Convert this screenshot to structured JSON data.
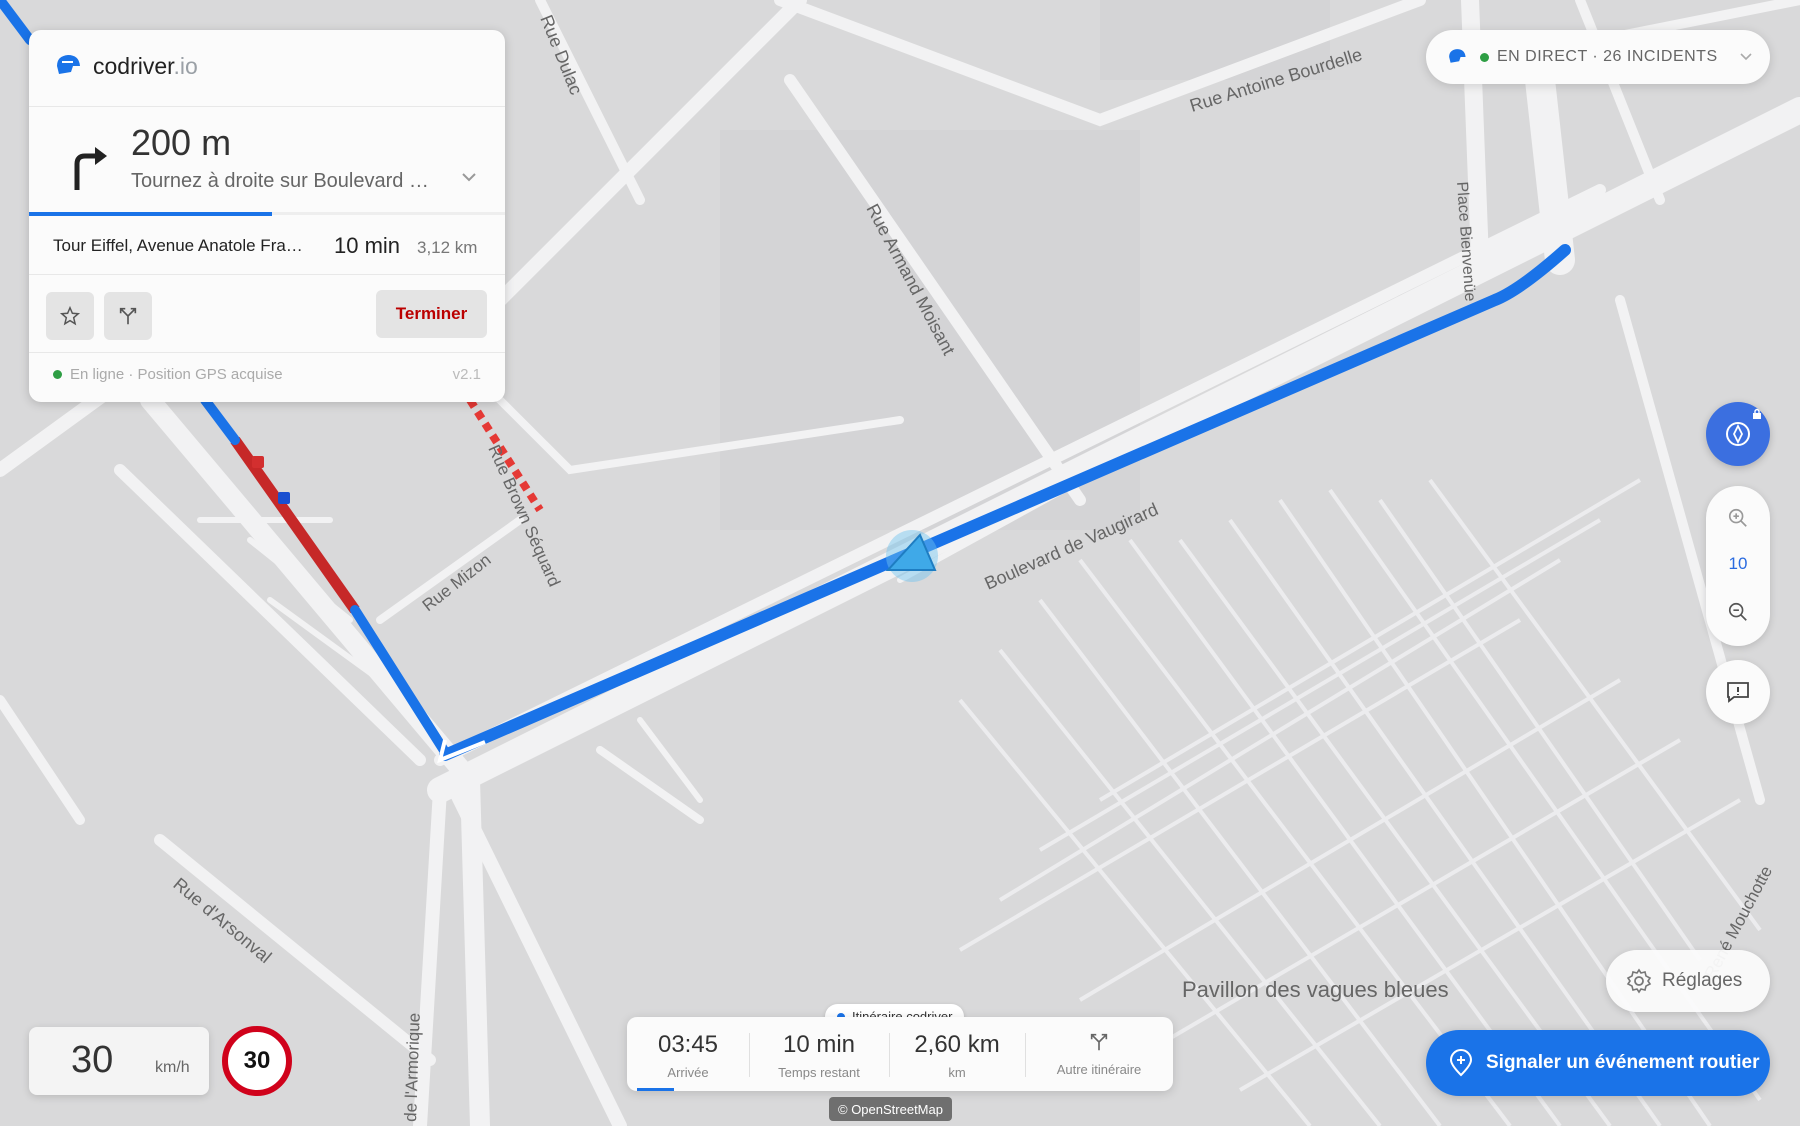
{
  "brand": {
    "name": "codriver",
    "tld": ".io"
  },
  "navigation": {
    "distance": "200 m",
    "instruction": "Tournez à droite sur Boulevard …",
    "destination": "Tour Eiffel, Avenue Anatole Fra…",
    "eta_duration": "10 min",
    "total_distance": "3,12 km",
    "end_label": "Terminer",
    "status": "En ligne · Position GPS acquise",
    "version": "v2.1",
    "progress": 0.51
  },
  "live": {
    "label": "EN DIRECT · 26 INCIDENTS"
  },
  "zoom": {
    "level": "10"
  },
  "settings": {
    "label": "Réglages"
  },
  "report": {
    "label": "Signaler un événement routier"
  },
  "speed": {
    "current": "30",
    "unit": "km/h",
    "limit": "30"
  },
  "trip": {
    "tag": "Itinéraire codriver",
    "arrival_time": "03:45",
    "arrival_label": "Arrivée",
    "remaining_time": "10 min",
    "remaining_label": "Temps restant",
    "remaining_distance": "2,60 km",
    "distance_unit": "km",
    "alt_route_label": "Autre itinéraire",
    "progress": 0.07
  },
  "attribution": "© OpenStreetMap",
  "map_labels": {
    "rue_dulac": "Rue Dulac",
    "rue_antoine_bourdelle": "Rue Antoine Bourdelle",
    "place_bienvenue": "Place Bienvenüe",
    "rue_armand_moisant": "Rue Armand Moisant",
    "boulevard_vaugirard": "Boulevard de Vaugirard",
    "rue_brown_sequard": "Rue Brown Séquard",
    "rue_mizon": "Rue Mizon",
    "rue_darsonval": "Rue d'Arsonval",
    "rue_armorique": "de l'Armorique",
    "rene_mouchotte": "René Mouchotte",
    "pavillon": "Pavillon des vagues bleues"
  },
  "colors": {
    "route": "#1a73e8",
    "traffic": "#d32f2f",
    "accent": "#3b6fe0",
    "limit_ring": "#d0021b"
  }
}
